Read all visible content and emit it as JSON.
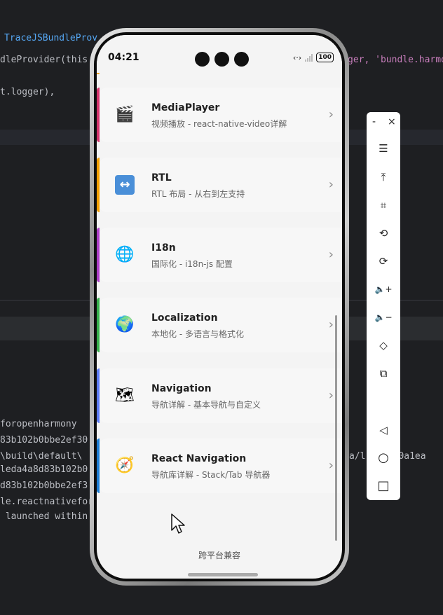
{
  "ide": {
    "lines": [
      {
        "text": "TraceJSBundleProv"
      },
      {
        "text": "dleProvider(this"
      },
      {
        "text": "t.logger),"
      },
      {
        "text": "foropenharmony"
      },
      {
        "text": "83b102b0bbe2ef30"
      },
      {
        "text": "\\build\\default\\"
      },
      {
        "text": "leda4a8d83b102b0"
      },
      {
        "text": "d83b102b0bbe2ef3"
      },
      {
        "text": "le.reactnativefor"
      },
      {
        "text": " launched within"
      },
      {
        "text": "ger, 'bundle.harmo"
      },
      {
        "text": "a/l   mp/0a1ea"
      }
    ]
  },
  "status_bar": {
    "time": "04:21",
    "battery": "100"
  },
  "items": [
    {
      "title": "MediaPlayer",
      "subtitle": "视频播放 - react-native-video详解",
      "icon": "clapper-icon",
      "glyph": "🎬",
      "accent": "#d6336c"
    },
    {
      "title": "RTL",
      "subtitle": "RTL 布局 - 从右到左支持",
      "icon": "left-right-arrow-icon",
      "glyph": "↔",
      "accent": "#f59f00"
    },
    {
      "title": "I18n",
      "subtitle": "国际化 - i18n-js 配置",
      "icon": "globe-meridians-icon",
      "glyph": "🌐",
      "accent": "#ae3ec9"
    },
    {
      "title": "Localization",
      "subtitle": "本地化 - 多语言与格式化",
      "icon": "earth-globe-icon",
      "glyph": "🌍",
      "accent": "#37b24d"
    },
    {
      "title": "Navigation",
      "subtitle": "导航详解 - 基本导航与自定义",
      "icon": "map-icon",
      "glyph": "🗺",
      "accent": "#5c7cfa"
    },
    {
      "title": "React Navigation",
      "subtitle": "导航库详解 - Stack/Tab 导航器",
      "icon": "compass-icon",
      "glyph": "🧭",
      "accent": "#1c7ed6"
    }
  ],
  "footer": "跨平台兼容",
  "chevron": "›",
  "toolbar": {
    "minimize": "-",
    "close": "×",
    "buttons": [
      {
        "icon": "menu-icon",
        "glyph": "☰"
      },
      {
        "icon": "pin-top-icon",
        "glyph": "⤒"
      },
      {
        "icon": "crop-icon",
        "glyph": "⌗"
      },
      {
        "icon": "rotate-left-icon",
        "glyph": "⟲"
      },
      {
        "icon": "rotate-right-icon",
        "glyph": "⟳"
      },
      {
        "icon": "volume-up-icon",
        "glyph": "🔈+"
      },
      {
        "icon": "volume-down-icon",
        "glyph": "🔈−"
      },
      {
        "icon": "shake-icon",
        "glyph": "◇"
      },
      {
        "icon": "multi-device-icon",
        "glyph": "⧉"
      },
      {
        "icon": "back-icon",
        "glyph": "◁"
      },
      {
        "icon": "home-icon",
        "glyph": "○"
      },
      {
        "icon": "recents-icon",
        "glyph": "□"
      }
    ]
  }
}
